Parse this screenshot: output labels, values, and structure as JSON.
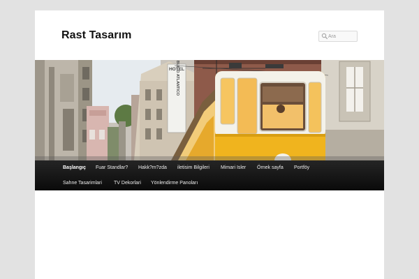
{
  "site": {
    "title": "Rast Tasarım"
  },
  "search": {
    "placeholder": "Ara"
  },
  "banner": {
    "sign_hotel": "HOTEL",
    "sign_name": "BUICO ATLANTICO"
  },
  "nav": {
    "row1": [
      {
        "label": "Başlangıç",
        "active": true
      },
      {
        "label": "Fuar Standlar?"
      },
      {
        "label": "Hakk?m?zda"
      },
      {
        "label": "iletisim Bilgileri"
      },
      {
        "label": "Mimari Isler"
      },
      {
        "label": "Örnek sayfa"
      },
      {
        "label": "Portföy"
      }
    ],
    "row2": [
      {
        "label": "Sahne Tasarimlari"
      },
      {
        "label": "TV Dekorlari"
      },
      {
        "label": "Yönlendirme Panoları"
      }
    ]
  },
  "colors": {
    "page_bg": "#e2e2e2",
    "content_bg": "#ffffff",
    "nav_bg": "#1a1a1a",
    "tram_yellow": "#f0b41e"
  }
}
